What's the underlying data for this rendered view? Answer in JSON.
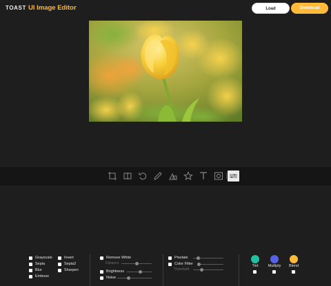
{
  "header": {
    "brand_toast": "TOAST",
    "brand_app": "UI Image Editor",
    "load_label": "Load",
    "download_label": "Download"
  },
  "filters": {
    "group1_col1": [
      "Grayscale",
      "Sepia",
      "Blur",
      "Emboss"
    ],
    "group1_col2": [
      "Invert",
      "Sepia2",
      "Sharpen"
    ],
    "remove_white": "Remove White",
    "distance": "Distance",
    "brightness": "Brightness",
    "noise": "Noise",
    "pixelate": "Pixelate",
    "color_filter": "Color Filter",
    "threshold": "Threshold",
    "tint": "Tint",
    "multiply": "Multiply",
    "blend": "Blend"
  },
  "colors": {
    "tint": "#1fc1a0",
    "multiply": "#5562e8",
    "blend": "#fdba3b",
    "accent": "#fdba3b"
  },
  "toolbar": {
    "tools": [
      "crop-icon",
      "flip-icon",
      "rotate-icon",
      "draw-icon",
      "shape-icon",
      "icon-icon",
      "text-icon",
      "mask-icon",
      "filter-icon"
    ],
    "active": "filter-icon"
  }
}
